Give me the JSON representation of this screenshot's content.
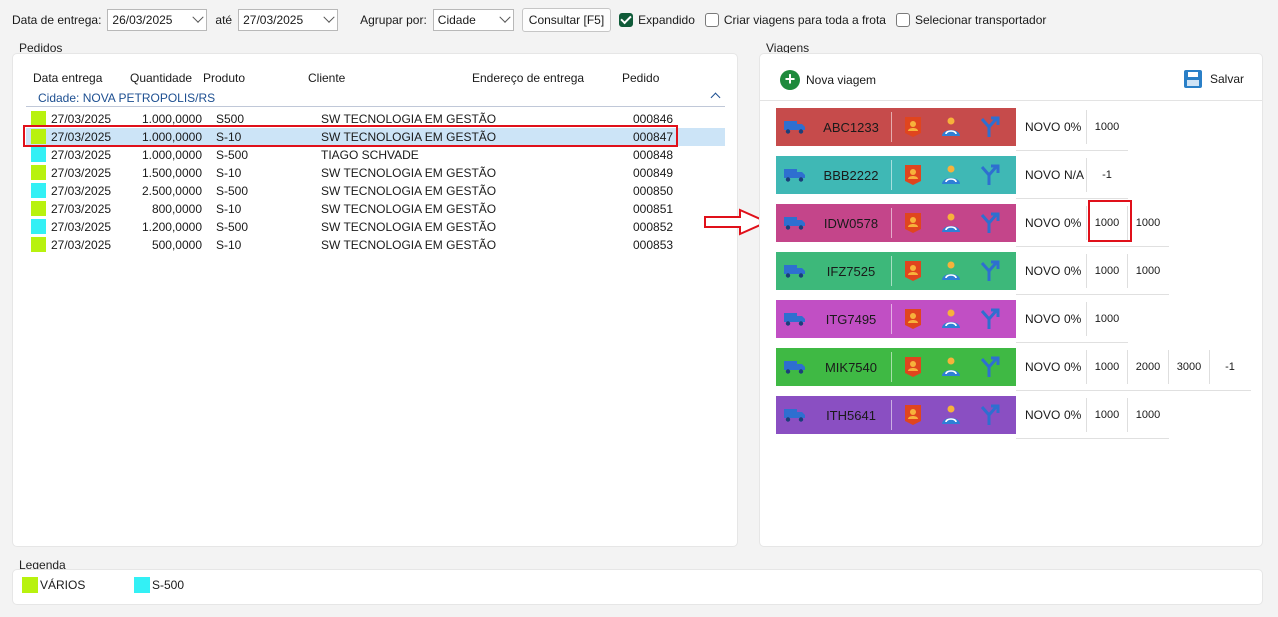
{
  "toolbar": {
    "date_label": "Data de entrega:",
    "date_from": "26/03/2025",
    "date_sep": "até",
    "date_to": "27/03/2025",
    "group_label": "Agrupar por:",
    "group_value": "Cidade",
    "consult_button": "Consultar [F5]",
    "expanded_label": "Expandido",
    "expanded_checked": true,
    "fleet_label": "Criar viagens para toda a frota",
    "carrier_label": "Selecionar transportador"
  },
  "orders": {
    "title": "Pedidos",
    "columns": [
      "Data entrega",
      "Quantidade",
      "Produto",
      "Cliente",
      "Endereço de entrega",
      "Pedido"
    ],
    "group": "Cidade: NOVA PETROPOLIS/RS",
    "rows": [
      {
        "color": "#b8f20e",
        "date": "27/03/2025",
        "qty": "1.000,0000",
        "product": "S500",
        "client": "SW TECNOLOGIA EM GESTÃO",
        "order": "000846"
      },
      {
        "color": "#b8f20e",
        "date": "27/03/2025",
        "qty": "1.000,0000",
        "product": "S-10",
        "client": "SW TECNOLOGIA EM GESTÃO",
        "order": "000847"
      },
      {
        "color": "#33f0f5",
        "date": "27/03/2025",
        "qty": "1.000,0000",
        "product": "S-500",
        "client": "TIAGO SCHVADE",
        "order": "000848"
      },
      {
        "color": "#b8f20e",
        "date": "27/03/2025",
        "qty": "1.500,0000",
        "product": "S-10",
        "client": "SW TECNOLOGIA EM GESTÃO",
        "order": "000849"
      },
      {
        "color": "#33f0f5",
        "date": "27/03/2025",
        "qty": "2.500,0000",
        "product": "S-500",
        "client": "SW TECNOLOGIA EM GESTÃO",
        "order": "000850"
      },
      {
        "color": "#b8f20e",
        "date": "27/03/2025",
        "qty": "800,0000",
        "product": "S-10",
        "client": "SW TECNOLOGIA EM GESTÃO",
        "order": "000851"
      },
      {
        "color": "#33f0f5",
        "date": "27/03/2025",
        "qty": "1.200,0000",
        "product": "S-500",
        "client": "SW TECNOLOGIA EM GESTÃO",
        "order": "000852"
      },
      {
        "color": "#b8f20e",
        "date": "27/03/2025",
        "qty": "500,0000",
        "product": "S-10",
        "client": "SW TECNOLOGIA EM GESTÃO",
        "order": "000853"
      }
    ]
  },
  "trips": {
    "title": "Viagens",
    "new_trip_label": "Nova viagem",
    "save_label": "Salvar",
    "list": [
      {
        "plate": "ABC1233",
        "color": "#c64b4b",
        "status": "NOVO",
        "pct": "0%",
        "caps": [
          "1000"
        ],
        "route_icon": true
      },
      {
        "plate": "BBB2222",
        "color": "#3fb8b5",
        "status": "NOVO",
        "pct": "N/A",
        "caps": [
          "-1"
        ],
        "route_icon": false
      },
      {
        "plate": "IDW0578",
        "color": "#c4458a",
        "status": "NOVO",
        "pct": "0%",
        "caps": [
          "1000",
          "1000"
        ],
        "route_icon": true
      },
      {
        "plate": "IFZ7525",
        "color": "#3db87a",
        "status": "NOVO",
        "pct": "0%",
        "caps": [
          "1000",
          "1000"
        ],
        "route_icon": true
      },
      {
        "plate": "ITG7495",
        "color": "#c14fc4",
        "status": "NOVO",
        "pct": "0%",
        "caps": [
          "1000"
        ],
        "route_icon": false
      },
      {
        "plate": "MIK7540",
        "color": "#3fb944",
        "status": "NOVO",
        "pct": "0%",
        "caps": [
          "1000",
          "2000",
          "3000",
          "-1"
        ],
        "route_icon": false
      },
      {
        "plate": "ITH5641",
        "color": "#8a4fc2",
        "status": "NOVO",
        "pct": "0%",
        "caps": [
          "1000",
          "1000"
        ],
        "route_icon": true
      }
    ]
  },
  "legend": {
    "title": "Legenda",
    "items": [
      {
        "label": "VÁRIOS",
        "color": "#b8f20e"
      },
      {
        "label": "S-500",
        "color": "#33f0f5"
      }
    ]
  }
}
